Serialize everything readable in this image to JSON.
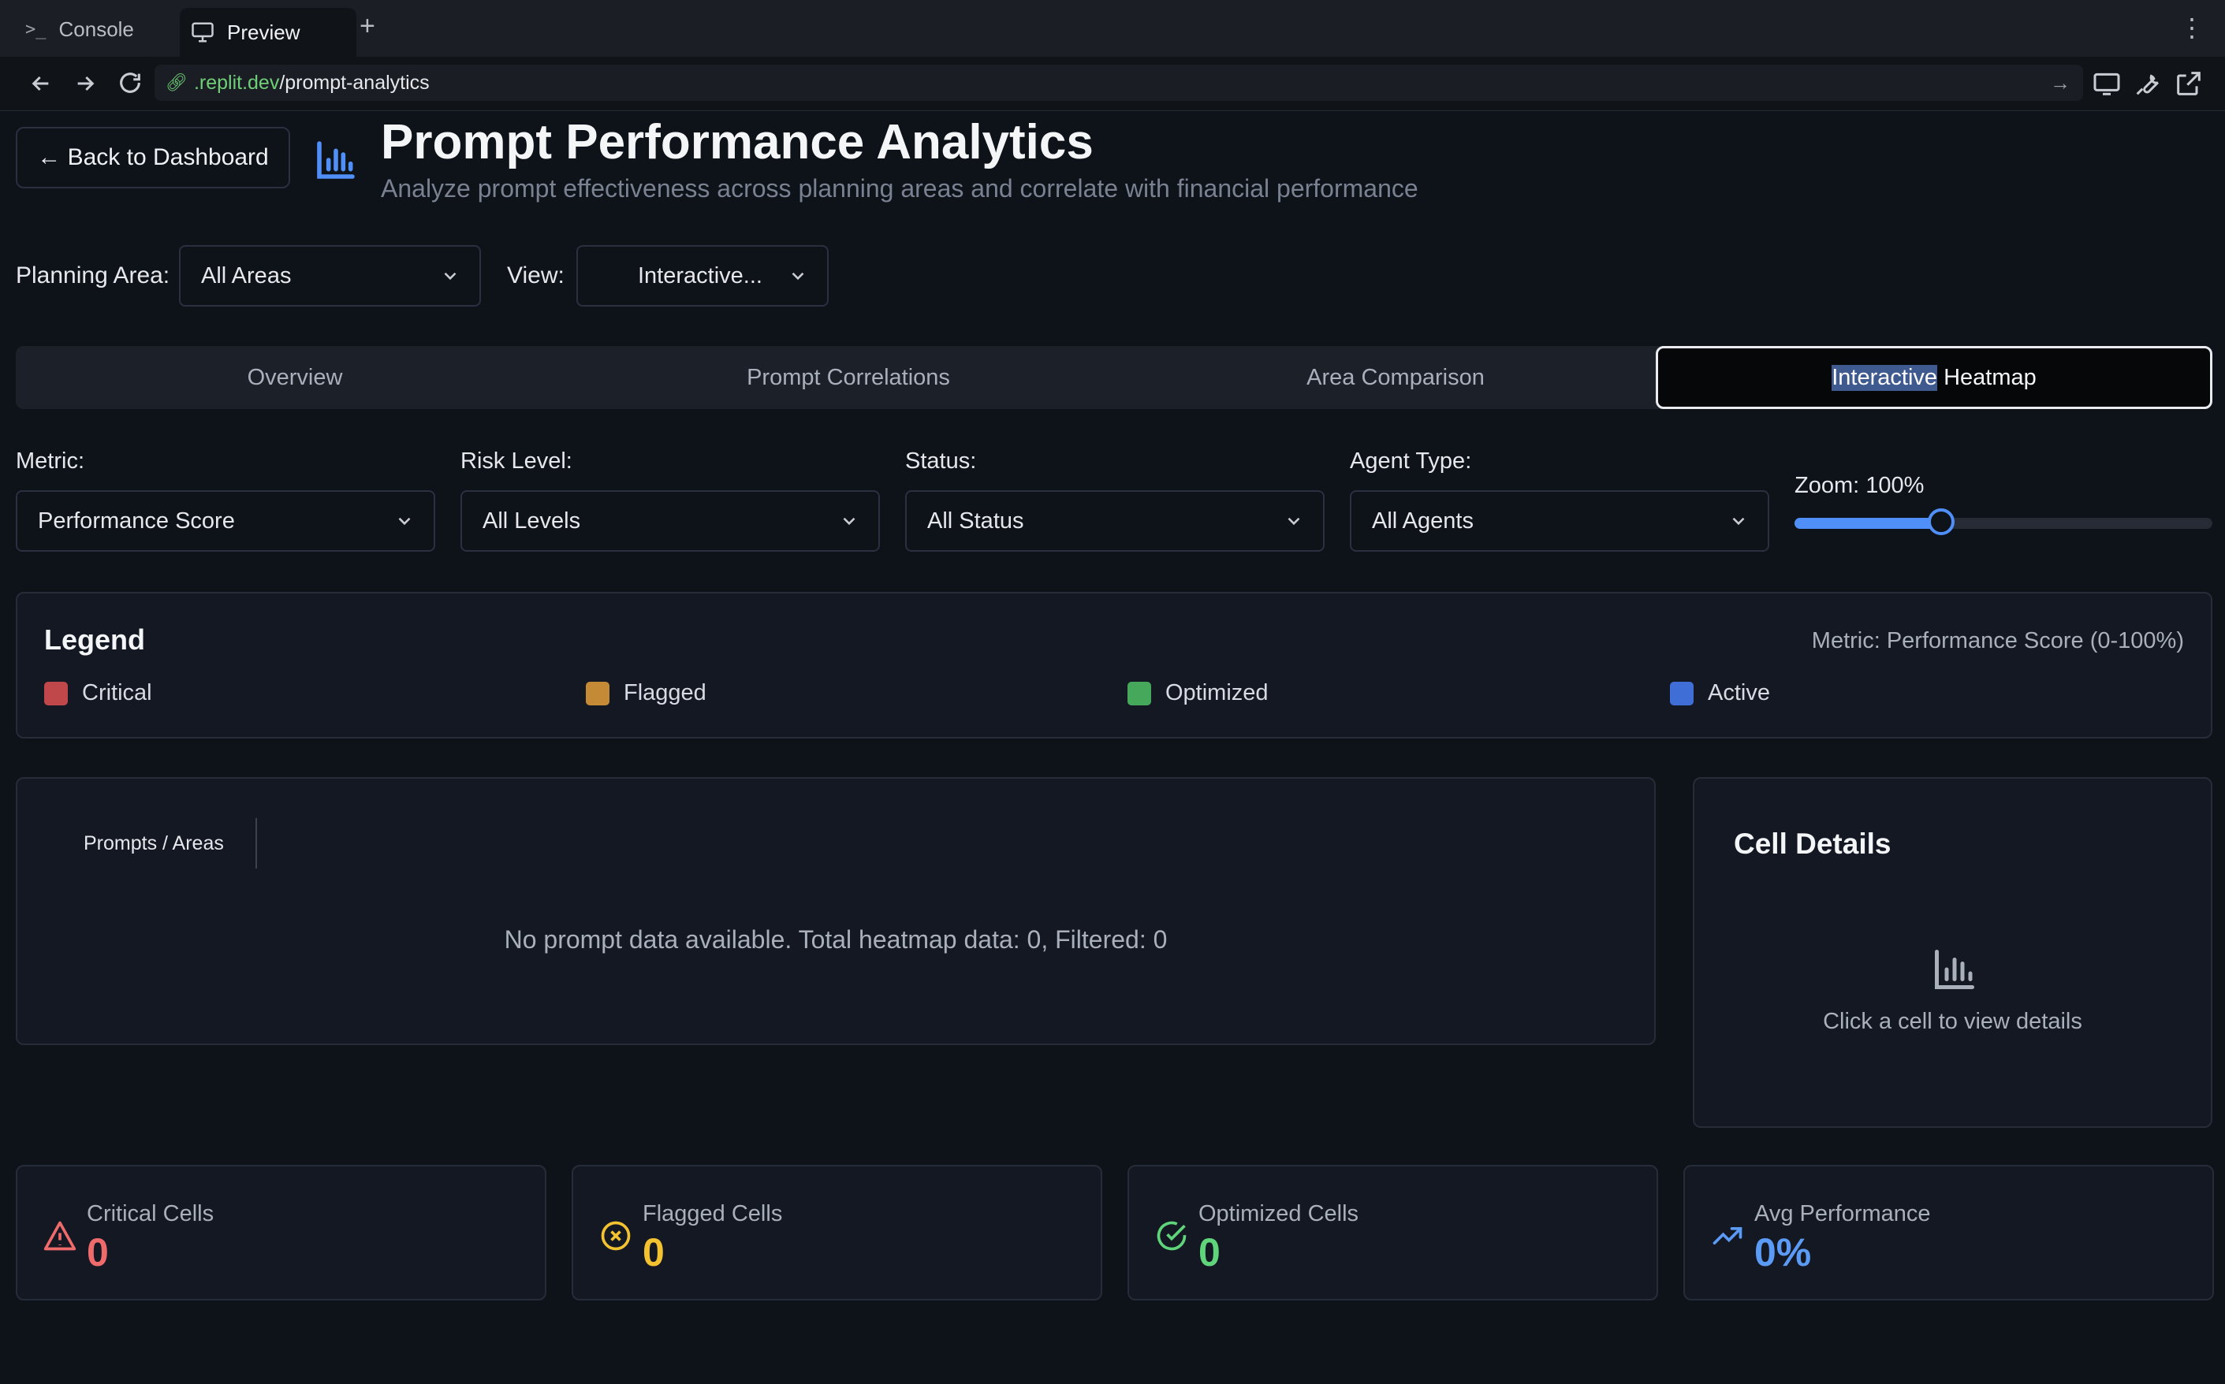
{
  "browser": {
    "tabs": [
      {
        "label": "Console",
        "glyph": ">_"
      },
      {
        "label": "Preview"
      }
    ],
    "new_tab": "+",
    "url_host": ".replit.dev",
    "url_path": "/prompt-analytics"
  },
  "header": {
    "back_label": "← Back to Dashboard",
    "title": "Prompt Performance Analytics",
    "subtitle": "Analyze prompt effectiveness across planning areas and correlate with financial performance",
    "icon": "bar-chart-icon",
    "accent": "#4f8ff7"
  },
  "filters": {
    "planning_area_label": "Planning Area:",
    "planning_area_value": "All Areas",
    "view_label": "View:",
    "view_value": "Interactive..."
  },
  "tabs": [
    {
      "label": "Overview"
    },
    {
      "label": "Prompt Correlations"
    },
    {
      "label": "Area Comparison"
    },
    {
      "label_highlight": "Interactive",
      "label_rest": " Heatmap",
      "active": true
    }
  ],
  "controls": {
    "metric_label": "Metric:",
    "metric_value": "Performance Score",
    "risk_label": "Risk Level:",
    "risk_value": "All Levels",
    "status_label": "Status:",
    "status_value": "All Status",
    "agent_label": "Agent Type:",
    "agent_value": "All Agents",
    "zoom_label": "Zoom: 100%",
    "zoom_fraction": 0.35
  },
  "legend": {
    "title": "Legend",
    "metric_note": "Metric: Performance Score (0-100%)",
    "items": [
      {
        "label": "Critical",
        "color": "#c0484a"
      },
      {
        "label": "Flagged",
        "color": "#c58a36"
      },
      {
        "label": "Optimized",
        "color": "#46a85a"
      },
      {
        "label": "Active",
        "color": "#3f6fd6"
      }
    ]
  },
  "heatmap": {
    "header": "Prompts / Areas",
    "empty_message": "No prompt data available. Total heatmap data: 0, Filtered: 0"
  },
  "details": {
    "title": "Cell Details",
    "message": "Click a cell to view details"
  },
  "stats": [
    {
      "label": "Critical Cells",
      "value": "0",
      "color": "#ef6b6b",
      "icon": "alert-triangle-icon"
    },
    {
      "label": "Flagged Cells",
      "value": "0",
      "color": "#f2c230",
      "icon": "x-circle-icon"
    },
    {
      "label": "Optimized Cells",
      "value": "0",
      "color": "#5fd47a",
      "icon": "check-circle-icon"
    },
    {
      "label": "Avg Performance",
      "value": "0%",
      "color": "#5b9bf5",
      "icon": "trending-up-icon"
    }
  ]
}
